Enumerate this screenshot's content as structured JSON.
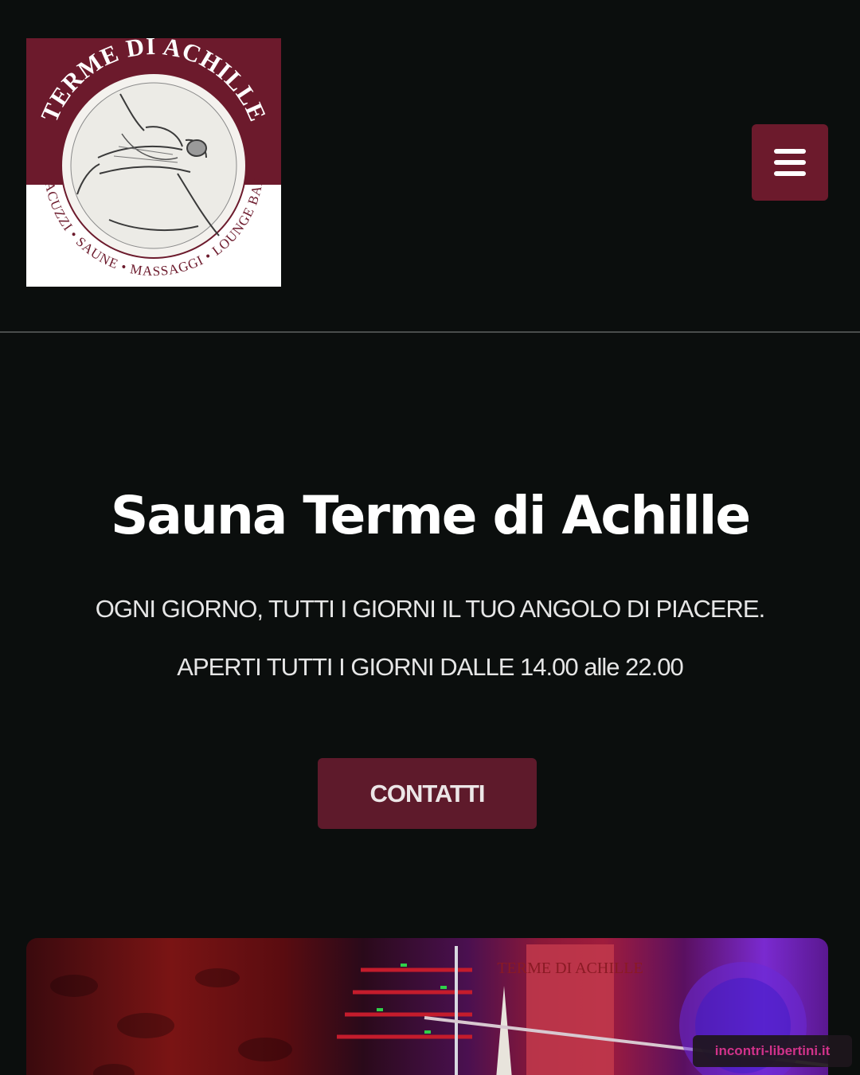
{
  "header": {
    "logo": {
      "title_arc": "TERME DI ACHILLE",
      "subtitle_arc": "JACUZZI • SAUNE • MASSAGGI • LOUNGE BAR"
    },
    "menu_icon": "hamburger-menu-icon"
  },
  "hero": {
    "title": "Sauna Terme di Achille",
    "tagline": "OGNI GIORNO, TUTTI I GIORNI IL TUO ANGOLO DI PIACERE.",
    "hours": "APERTI TUTTI I GIORNI DALLE 14.00 alle 22.00",
    "cta_label": "CONTATTI"
  },
  "photo": {
    "sign_text": "TERME DI ACHILLE"
  },
  "watermark": "incontri-libertini.it",
  "colors": {
    "background": "#0b0e0d",
    "brand": "#6c1a2c",
    "button": "#5e1a2b",
    "watermark_text": "#d0328a"
  }
}
